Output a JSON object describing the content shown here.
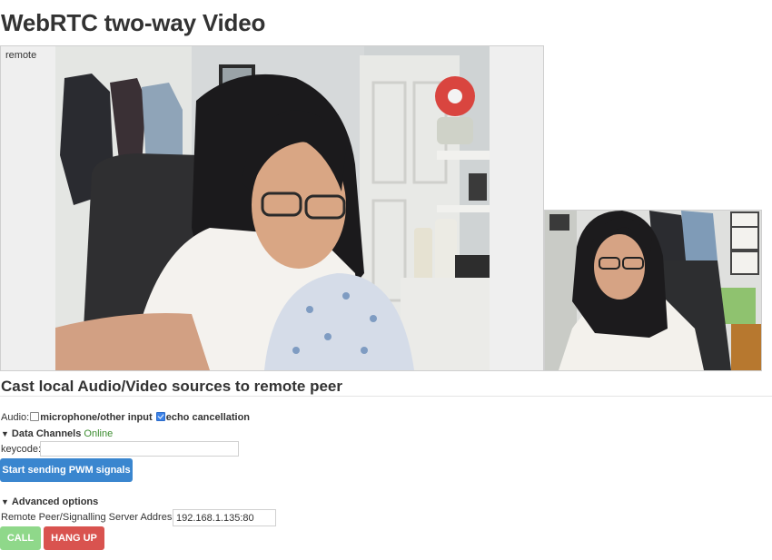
{
  "page": {
    "title": "WebRTC two-way Video"
  },
  "remote_video": {
    "label": "remote"
  },
  "section": {
    "title": "Cast local Audio/Video sources to remote peer"
  },
  "audio": {
    "label": "Audio:",
    "microphone_label": "microphone/other input",
    "microphone_checked": false,
    "echo_label": "echo cancellation",
    "echo_checked": true
  },
  "data_channels": {
    "label": "Data Channels",
    "status": "Online",
    "status_color": "#3c8d2f",
    "keycode_label": "keycode:",
    "keycode_value": "",
    "send_button": "Start sending PWM signals"
  },
  "advanced": {
    "label": "Advanced options",
    "server_label": "Remote Peer/Signalling Server Address:",
    "server_value": "192.168.1.135:80"
  },
  "controls": {
    "call_button": "CALL",
    "hangup_button": "HANG UP"
  },
  "colors": {
    "primary": "#3a86cf",
    "call": "#8fd88a",
    "hangup": "#d9534f"
  }
}
